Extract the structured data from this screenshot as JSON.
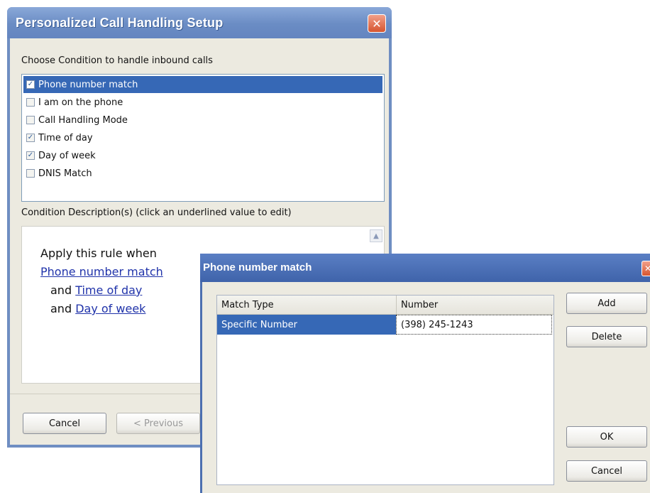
{
  "main_dialog": {
    "title": "Personalized Call Handling Setup",
    "close_label": "✕",
    "conditions_label": "Choose Condition to handle inbound calls",
    "conditions": [
      {
        "label": "Phone number match",
        "checked": true,
        "selected": true
      },
      {
        "label": "I am on the phone",
        "checked": false,
        "selected": false
      },
      {
        "label": "Call Handling Mode",
        "checked": false,
        "selected": false
      },
      {
        "label": "Time of day",
        "checked": true,
        "selected": false
      },
      {
        "label": "Day of week",
        "checked": true,
        "selected": false
      },
      {
        "label": "DNIS Match",
        "checked": false,
        "selected": false
      }
    ],
    "description_label": "Condition Description(s) (click an underlined value to edit)",
    "rule": {
      "intro": "Apply this rule when",
      "link1": "Phone number match",
      "and": "and",
      "link2": "Time of day",
      "link3": "Day of week"
    },
    "scroll_up_glyph": "▲",
    "buttons": {
      "cancel": "Cancel",
      "previous": "< Previous"
    }
  },
  "child_dialog": {
    "title": "Phone number match",
    "close_label": "✕",
    "columns": [
      "Match Type",
      "Number"
    ],
    "rows": [
      {
        "match_type": "Specific Number",
        "number": "(398) 245-1243"
      }
    ],
    "buttons": {
      "add": "Add",
      "delete": "Delete",
      "ok": "OK",
      "cancel": "Cancel"
    }
  },
  "colors": {
    "title_bar": "#6a8cc4",
    "selection": "#3668b6",
    "link": "#2033aa",
    "dialog_face": "#eceae0"
  }
}
